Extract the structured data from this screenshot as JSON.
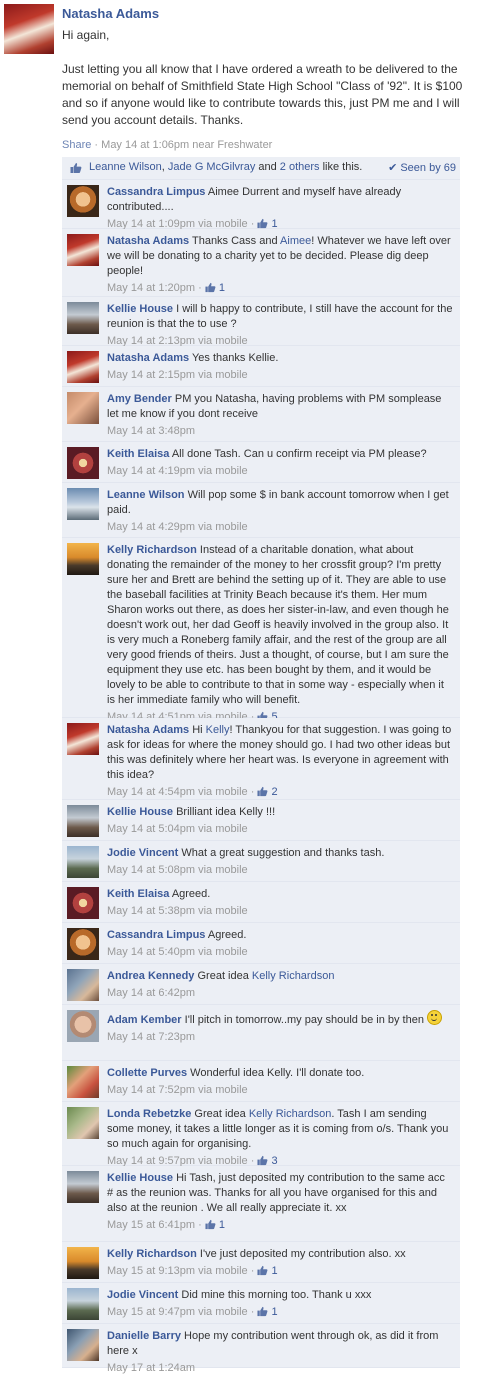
{
  "post": {
    "author": "Natasha Adams",
    "avatar_icon": "profile-photo-santa",
    "greeting": "Hi again,",
    "body": "Just letting you all know that I have ordered a wreath to be delivered to the memorial on behalf of Smithfield State High School \"Class of '92\". It is $100 and so if anyone would like to contribute towards this, just PM me and I will send you account details. Thanks.",
    "share_label": "Share",
    "timestamp": "May 14 at 1:06pm near Freshwater",
    "likes": {
      "liker1": "Leanne Wilson",
      "sep": ", ",
      "liker2": "Jade G McGilvray",
      "and": " and ",
      "others": "2 others",
      "suffix": " like this.",
      "seen_by": "Seen by 69"
    }
  },
  "comments": [
    {
      "author": "Cassandra Limpus",
      "avatar": "cassandra",
      "text": "Aimee Durrent and myself have already contributed....",
      "link": "",
      "text_after": "",
      "time": "May 14 at 1:09pm via mobile",
      "likes": "1"
    },
    {
      "author": "Natasha Adams",
      "avatar": "natasha",
      "text": "Thanks Cass and ",
      "link": "Aimee",
      "text_after": "! Whatever we have left over we will be donating to a charity yet to be decided. Please dig deep people!",
      "time": "May 14 at 1:20pm",
      "likes": "1"
    },
    {
      "author": "Kellie House",
      "avatar": "kellie",
      "text": "I will b happy to contribute, I still have the account for the reunion is that the to use ?",
      "link": "",
      "text_after": "",
      "time": "May 14 at 2:13pm via mobile",
      "likes": ""
    },
    {
      "author": "Natasha Adams",
      "avatar": "natasha",
      "text": "Yes thanks Kellie.",
      "link": "",
      "text_after": "",
      "time": "May 14 at 2:15pm via mobile",
      "likes": ""
    },
    {
      "author": "Amy Bender",
      "avatar": "amy",
      "text": "PM you Natasha, having problems with PM somplease let me know if you dont receive",
      "link": "",
      "text_after": "",
      "time": "May 14 at 3:48pm",
      "likes": ""
    },
    {
      "author": "Keith Elaisa",
      "avatar": "keith",
      "text": "All done Tash. Can u confirm receipt via PM please?",
      "link": "",
      "text_after": "",
      "time": "May 14 at 4:19pm via mobile",
      "likes": ""
    },
    {
      "author": "Leanne Wilson",
      "avatar": "leanne",
      "text": "Will pop some $ in bank account tomorrow when I get paid.",
      "link": "",
      "text_after": "",
      "time": "May 14 at 4:29pm via mobile",
      "likes": ""
    },
    {
      "author": "Kelly Richardson",
      "avatar": "kelly",
      "text": "Instead of a charitable donation, what about donating the remainder of the money to her crossfit group? I'm pretty sure her and Brett are behind the setting up of it. They are able to use the baseball facilities at Trinity Beach because it's them. Her mum Sharon works out there, as does her sister-in-law, and even though he doesn't work out, her dad Geoff is heavily involved in the group also. It is very much a Roneberg family affair, and the rest of the group are all very good friends of theirs. Just a thought, of course, but I am sure the equipment they use etc. has been bought by them, and it would be lovely to be able to contribute to that in some way - especially when it is her immediate family who will benefit.",
      "link": "",
      "text_after": "",
      "time": "May 14 at 4:51pm via mobile",
      "likes": "5"
    },
    {
      "author": "Natasha Adams",
      "avatar": "natasha",
      "text": "Hi ",
      "link": "Kelly",
      "text_after": "! Thankyou for that suggestion. I was going to ask for ideas for where the money should go. I had two other ideas but this was definitely where her heart was. Is everyone in agreement with this idea?",
      "time": "May 14 at 4:54pm via mobile",
      "likes": "2"
    },
    {
      "author": "Kellie House",
      "avatar": "kellie",
      "text": "Brilliant idea Kelly !!!",
      "link": "",
      "text_after": "",
      "time": "May 14 at 5:04pm via mobile",
      "likes": ""
    },
    {
      "author": "Jodie Vincent",
      "avatar": "jodie",
      "text": "What a great suggestion and thanks tash.",
      "link": "",
      "text_after": "",
      "time": "May 14 at 5:08pm via mobile",
      "likes": ""
    },
    {
      "author": "Keith Elaisa",
      "avatar": "keith",
      "text": "Agreed.",
      "link": "",
      "text_after": "",
      "time": "May 14 at 5:38pm via mobile",
      "likes": ""
    },
    {
      "author": "Cassandra Limpus",
      "avatar": "cassandra",
      "text": "Agreed.",
      "link": "",
      "text_after": "",
      "time": "May 14 at 5:40pm via mobile",
      "likes": ""
    },
    {
      "author": "Andrea Kennedy",
      "avatar": "andrea",
      "text": "Great idea ",
      "link": "Kelly Richardson",
      "text_after": "",
      "time": "May 14 at 6:42pm",
      "likes": ""
    },
    {
      "author": "Adam Kember",
      "avatar": "adam",
      "text": "I'll pitch in tomorrow..my pay should be in by then ",
      "link": "",
      "text_after": "",
      "smiley": true,
      "time": "May 14 at 7:23pm",
      "likes": ""
    },
    {
      "author": "Collette Purves",
      "avatar": "collette",
      "text": "Wonderful idea Kelly. I'll donate too.",
      "link": "",
      "text_after": "",
      "time": "May 14 at 7:52pm via mobile",
      "likes": ""
    },
    {
      "author": "Londa Rebetzke",
      "avatar": "londa",
      "text": "Great idea ",
      "link": "Kelly Richardson",
      "text_after": ". Tash I am sending some money, it takes a little longer as it is coming from o/s. Thank you so much again for organising.",
      "time": "May 14 at 9:57pm via mobile",
      "likes": "3"
    },
    {
      "author": "Kellie House",
      "avatar": "kellie",
      "text": "Hi Tash, just deposited my contribution to the same acc # as the reunion was. Thanks for all you have organised for this and also at the reunion . We all really appreciate it. xx",
      "link": "",
      "text_after": "",
      "time": "May 15 at 6:41pm",
      "likes": "1"
    },
    {
      "author": "Kelly Richardson",
      "avatar": "kelly",
      "text": "I've just deposited my contribution also. xx",
      "link": "",
      "text_after": "",
      "time": "May 15 at 9:13pm via mobile",
      "likes": "1"
    },
    {
      "author": "Jodie Vincent",
      "avatar": "jodie",
      "text": "Did mine this morning too. Thank u xxx",
      "link": "",
      "text_after": "",
      "time": "May 15 at 9:47pm via mobile",
      "likes": "1"
    },
    {
      "author": "Danielle Barry",
      "avatar": "danielle",
      "text": "Hope my contribution went through ok, as did it from here x",
      "link": "",
      "text_after": "",
      "time": "May 17 at 1:24am",
      "likes": ""
    }
  ]
}
